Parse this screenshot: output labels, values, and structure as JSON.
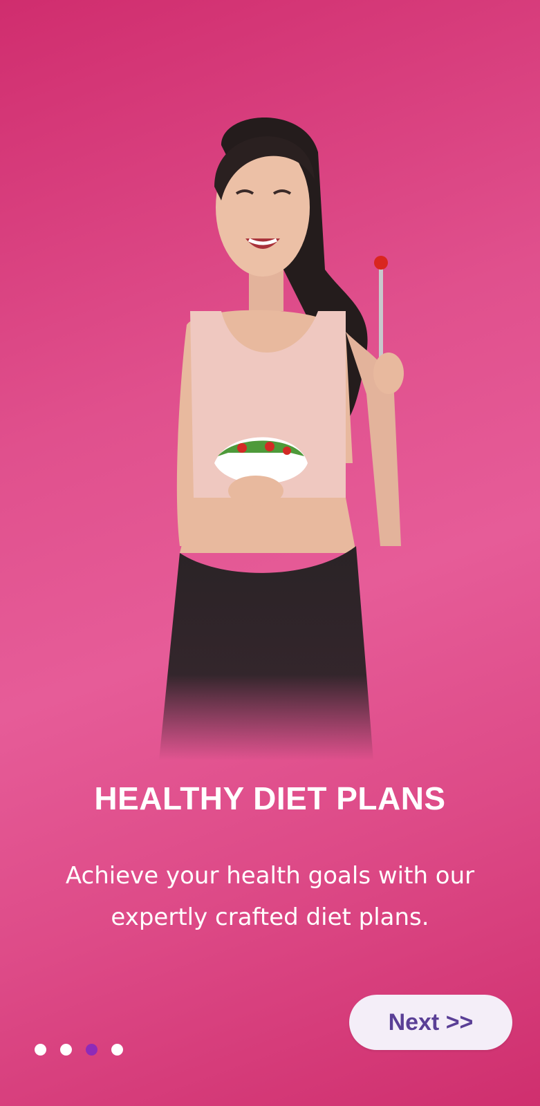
{
  "onboarding": {
    "title": "HEALTHY DIET PLANS",
    "description": "Achieve your health goals with our expertly crafted diet plans.",
    "next_label": "Next >>",
    "hero_image": "woman-eating-salad-illustration",
    "page_count": 4,
    "active_page": 3
  },
  "colors": {
    "background": "#dd4a87",
    "button_bg": "#f4eef8",
    "button_text": "#5a3f96",
    "dot_active": "#8e2bb8",
    "dot_inactive": "#ffffff"
  }
}
